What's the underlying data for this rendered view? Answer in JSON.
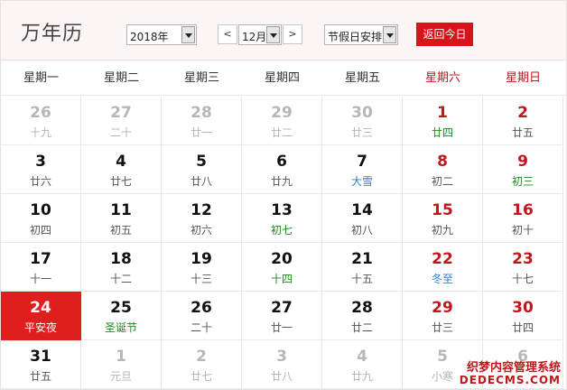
{
  "header": {
    "title": "万年历",
    "year_select": "2018年",
    "prev_label": "<",
    "month_select": "12月",
    "next_label": ">",
    "holiday_select": "节假日安排",
    "today_button": "返回今日"
  },
  "weekdays": [
    {
      "label": "星期一",
      "weekend": false
    },
    {
      "label": "星期二",
      "weekend": false
    },
    {
      "label": "星期三",
      "weekend": false
    },
    {
      "label": "星期四",
      "weekend": false
    },
    {
      "label": "星期五",
      "weekend": false
    },
    {
      "label": "星期六",
      "weekend": true
    },
    {
      "label": "星期日",
      "weekend": true
    }
  ],
  "weeks": [
    [
      {
        "day": "26",
        "lunar": "十九",
        "other": true
      },
      {
        "day": "27",
        "lunar": "二十",
        "other": true
      },
      {
        "day": "28",
        "lunar": "廿一",
        "other": true
      },
      {
        "day": "29",
        "lunar": "廿二",
        "other": true
      },
      {
        "day": "30",
        "lunar": "廿三",
        "other": true
      },
      {
        "day": "1",
        "lunar": "廿四",
        "kind": "fest"
      },
      {
        "day": "2",
        "lunar": "廿五"
      }
    ],
    [
      {
        "day": "3",
        "lunar": "廿六"
      },
      {
        "day": "4",
        "lunar": "廿七"
      },
      {
        "day": "5",
        "lunar": "廿八"
      },
      {
        "day": "6",
        "lunar": "廿九"
      },
      {
        "day": "7",
        "lunar": "大雪",
        "kind": "term"
      },
      {
        "day": "8",
        "lunar": "初二"
      },
      {
        "day": "9",
        "lunar": "初三",
        "kind": "fest"
      }
    ],
    [
      {
        "day": "10",
        "lunar": "初四"
      },
      {
        "day": "11",
        "lunar": "初五"
      },
      {
        "day": "12",
        "lunar": "初六"
      },
      {
        "day": "13",
        "lunar": "初七",
        "kind": "fest"
      },
      {
        "day": "14",
        "lunar": "初八"
      },
      {
        "day": "15",
        "lunar": "初九"
      },
      {
        "day": "16",
        "lunar": "初十"
      }
    ],
    [
      {
        "day": "17",
        "lunar": "十一"
      },
      {
        "day": "18",
        "lunar": "十二"
      },
      {
        "day": "19",
        "lunar": "十三"
      },
      {
        "day": "20",
        "lunar": "十四",
        "kind": "fest"
      },
      {
        "day": "21",
        "lunar": "十五"
      },
      {
        "day": "22",
        "lunar": "冬至",
        "kind": "term"
      },
      {
        "day": "23",
        "lunar": "十七"
      }
    ],
    [
      {
        "day": "24",
        "lunar": "平安夜",
        "today": true
      },
      {
        "day": "25",
        "lunar": "圣诞节",
        "kind": "fest"
      },
      {
        "day": "26",
        "lunar": "二十"
      },
      {
        "day": "27",
        "lunar": "廿一"
      },
      {
        "day": "28",
        "lunar": "廿二"
      },
      {
        "day": "29",
        "lunar": "廿三"
      },
      {
        "day": "30",
        "lunar": "廿四"
      }
    ],
    [
      {
        "day": "31",
        "lunar": "廿五"
      },
      {
        "day": "1",
        "lunar": "元旦",
        "other": true
      },
      {
        "day": "2",
        "lunar": "廿七",
        "other": true
      },
      {
        "day": "3",
        "lunar": "廿八",
        "other": true
      },
      {
        "day": "4",
        "lunar": "廿九",
        "other": true
      },
      {
        "day": "5",
        "lunar": "小寒",
        "other": true
      },
      {
        "day": "6",
        "lunar": "",
        "other": true
      }
    ]
  ],
  "watermark": {
    "line1": "织梦内容管理系统",
    "line2": "DEDECMS.COM"
  },
  "colors": {
    "accent_red": "#d7141a",
    "festival_green": "#1f8b1f",
    "solar_term_blue": "#2f7fc6"
  }
}
